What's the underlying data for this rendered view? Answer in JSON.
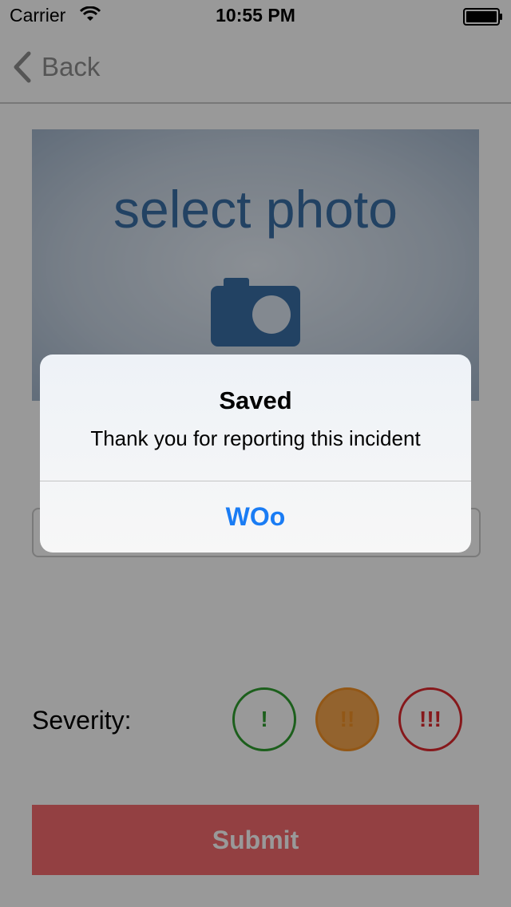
{
  "status_bar": {
    "carrier": "Carrier",
    "time": "10:55 PM",
    "wifi_icon": "wifi-icon",
    "battery_icon": "battery-icon"
  },
  "nav": {
    "back_label": "Back",
    "back_icon": "chevron-left-icon"
  },
  "photo": {
    "label": "select photo",
    "icon": "camera-icon"
  },
  "severity": {
    "label": "Severity:",
    "options": [
      "!",
      "!!",
      "!!!"
    ],
    "selected": "!!"
  },
  "submit_label": "Submit",
  "alert": {
    "title": "Saved",
    "message": "Thank you for reporting this incident",
    "button_label": "WOo"
  },
  "colors": {
    "accent_blue": "#1a7cf4",
    "photo_blue": "#3a6ea5",
    "severity_low": "#2f9e2f",
    "severity_medium": "#f39226",
    "severity_high": "#e0282e",
    "submit_background": "#f56b6f"
  }
}
